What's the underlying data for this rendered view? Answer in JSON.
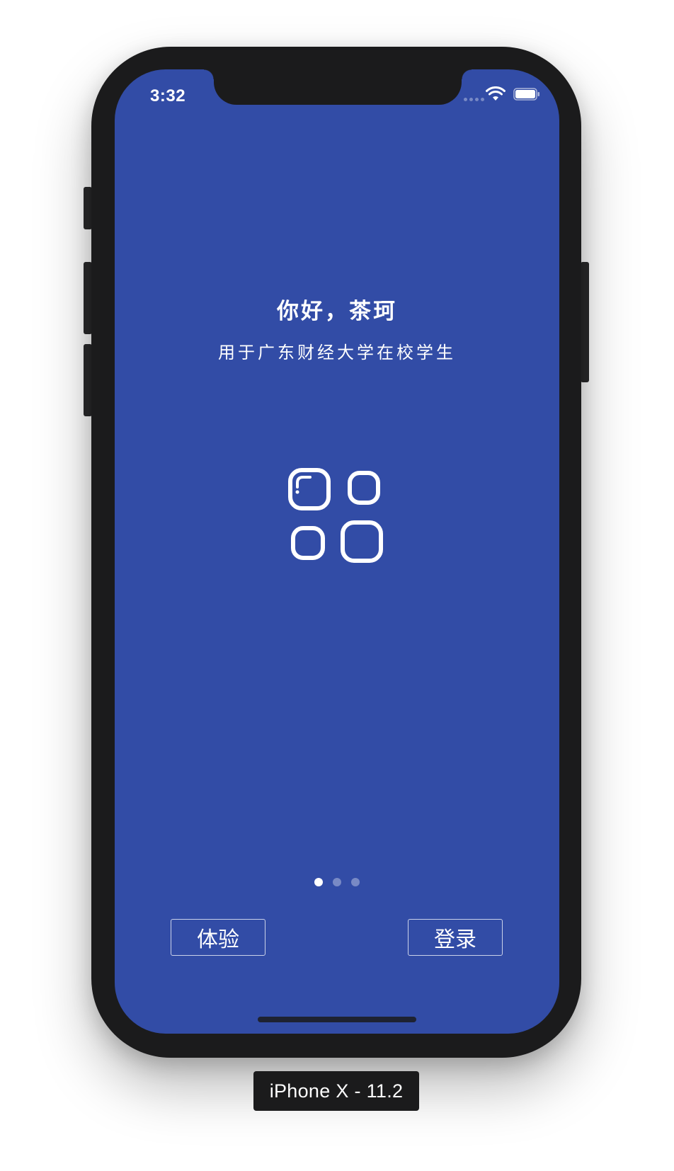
{
  "status_bar": {
    "time": "3:32"
  },
  "welcome": {
    "title": "你好，茶珂",
    "subtitle": "用于广东财经大学在校学生"
  },
  "app_icon": "app-grid-icon",
  "pager": {
    "pages": 3,
    "active_index": 0
  },
  "buttons": {
    "trial_label": "体验",
    "login_label": "登录"
  },
  "simulator": {
    "device_label": "iPhone X - 11.2"
  },
  "colors": {
    "screen_background": "#324ca6",
    "device_frame": "#1b1b1c",
    "foreground": "#ffffff"
  }
}
